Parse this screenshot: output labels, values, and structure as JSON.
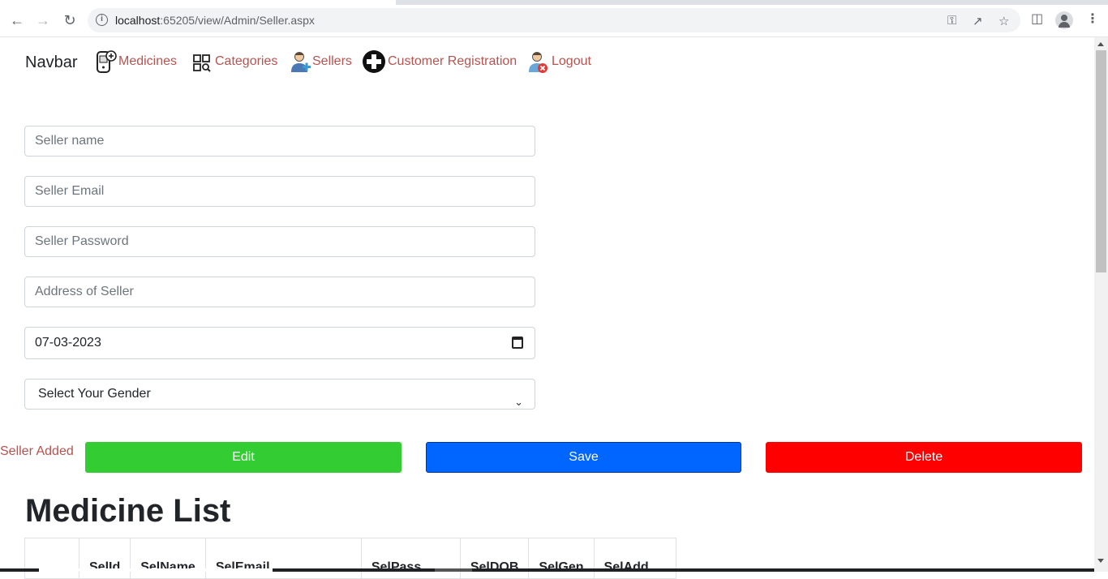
{
  "browser": {
    "url_host": "localhost",
    "url_rest": ":65205/view/Admin/Seller.aspx"
  },
  "navbar": {
    "brand": "Navbar",
    "items": [
      {
        "label": "Medicines",
        "icon": "medicine-phone-icon"
      },
      {
        "label": "Categories",
        "icon": "categories-grid-icon"
      },
      {
        "label": "Sellers",
        "icon": "seller-user-icon"
      },
      {
        "label": "Customer Registration",
        "icon": "plus-circle-icon"
      },
      {
        "label": "Logout",
        "icon": "logout-user-icon"
      }
    ]
  },
  "form": {
    "seller_name_placeholder": "Seller name",
    "seller_email_placeholder": "Seller Email",
    "seller_password_placeholder": "Seller Password",
    "seller_address_placeholder": "Address of Seller",
    "dob_value": "07-03-2023",
    "gender_selected": "Select Your Gender"
  },
  "status_message": "Seller Added",
  "buttons": {
    "edit": "Edit",
    "save": "Save",
    "delete": "Delete"
  },
  "list": {
    "heading": "Medicine List",
    "columns": [
      "",
      "SelId",
      "SelName",
      "SelEmail",
      "SelPass",
      "SelDOB",
      "SelGen",
      "SelAdd"
    ]
  },
  "colors": {
    "nav_link": "#b5534f",
    "edit": "#33cc33",
    "save": "#0066ff",
    "delete": "#ff0000"
  }
}
